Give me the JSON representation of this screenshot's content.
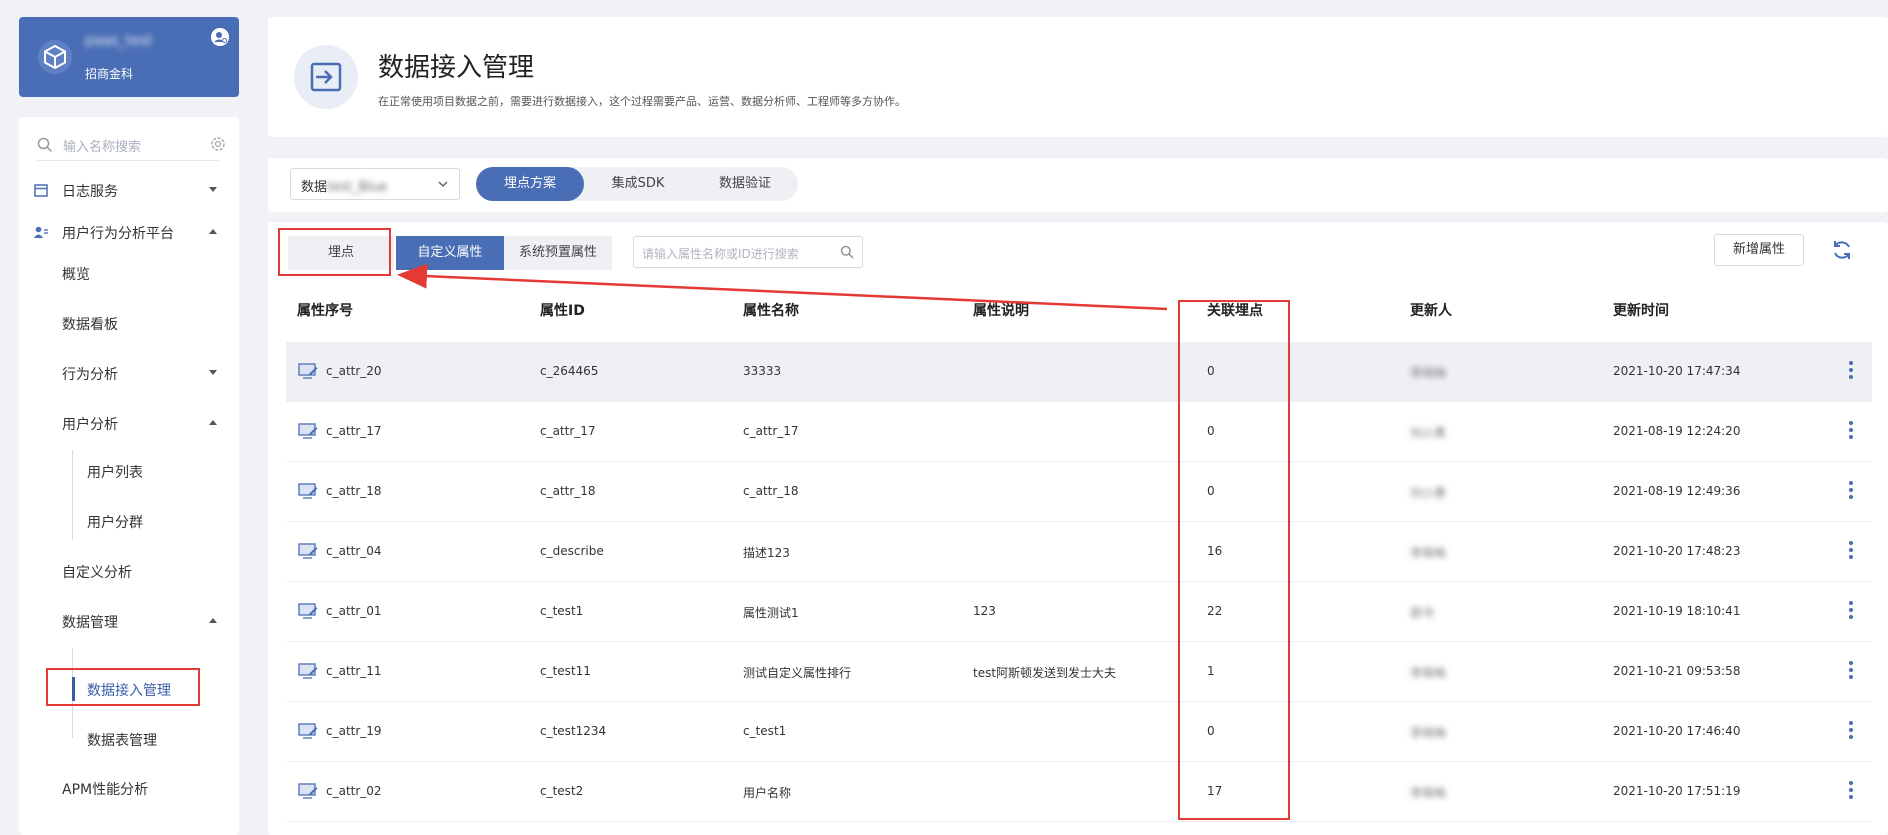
{
  "org": {
    "name": "paas_test",
    "sub": "招商金科"
  },
  "sidebar": {
    "search_placeholder": "输入名称搜索",
    "items": [
      {
        "label": "日志服务"
      },
      {
        "label": "用户行为分析平台"
      },
      {
        "label": "概览"
      },
      {
        "label": "数据看板"
      },
      {
        "label": "行为分析"
      },
      {
        "label": "用户分析"
      },
      {
        "label": "用户列表"
      },
      {
        "label": "用户分群"
      },
      {
        "label": "自定义分析"
      },
      {
        "label": "数据管理"
      },
      {
        "label": "数据接入管理"
      },
      {
        "label": "数据表管理"
      },
      {
        "label": "APM性能分析"
      }
    ]
  },
  "header": {
    "title": "数据接入管理",
    "desc": "在正常使用项目数据之前，需要进行数据接入，这个过程需要产品、运营、数据分析师、工程师等多方协作。"
  },
  "toolbar": {
    "dataset_prefix": "数据",
    "dataset_blurred": "test_Blue",
    "segments": [
      "埋点方案",
      "集成SDK",
      "数据验证"
    ]
  },
  "main": {
    "tabs": [
      "埋点",
      "自定义属性",
      "系统预置属性"
    ],
    "search_placeholder": "请输入属性名称或ID进行搜索",
    "add_label": "新增属性",
    "columns": [
      "属性序号",
      "属性ID",
      "属性名称",
      "属性说明",
      "关联埋点",
      "更新人",
      "更新时间"
    ],
    "rows": [
      {
        "seq": "c_attr_20",
        "id": "c_264465",
        "name": "33333",
        "desc": "",
        "count": "0",
        "user": "李晓梅",
        "time": "2021-10-20 17:47:34"
      },
      {
        "seq": "c_attr_17",
        "id": "c_attr_17",
        "name": "c_attr_17",
        "desc": "",
        "count": "0",
        "user": "刘小勇",
        "time": "2021-08-19 12:24:20"
      },
      {
        "seq": "c_attr_18",
        "id": "c_attr_18",
        "name": "c_attr_18",
        "desc": "",
        "count": "0",
        "user": "刘小勇",
        "time": "2021-08-19 12:49:36"
      },
      {
        "seq": "c_attr_04",
        "id": "c_describe",
        "name": "描述123",
        "desc": "",
        "count": "16",
        "user": "李晓梅",
        "time": "2021-10-20 17:48:23"
      },
      {
        "seq": "c_attr_01",
        "id": "c_test1",
        "name": "属性测试1",
        "desc": "123",
        "count": "22",
        "user": "郭书",
        "time": "2021-10-19 18:10:41"
      },
      {
        "seq": "c_attr_11",
        "id": "c_test11",
        "name": "测试自定义属性排行",
        "desc": "test阿斯顿发送到发士大夫",
        "count": "1",
        "user": "李晓梅",
        "time": "2021-10-21 09:53:58"
      },
      {
        "seq": "c_attr_19",
        "id": "c_test1234",
        "name": "c_test1",
        "desc": "",
        "count": "0",
        "user": "李晓梅",
        "time": "2021-10-20 17:46:40"
      },
      {
        "seq": "c_attr_02",
        "id": "c_test2",
        "name": "用户名称",
        "desc": "",
        "count": "17",
        "user": "李晓梅",
        "time": "2021-10-20 17:51:19"
      }
    ]
  },
  "colors": {
    "accent": "#4a6eb5",
    "annotation": "#e53935"
  }
}
